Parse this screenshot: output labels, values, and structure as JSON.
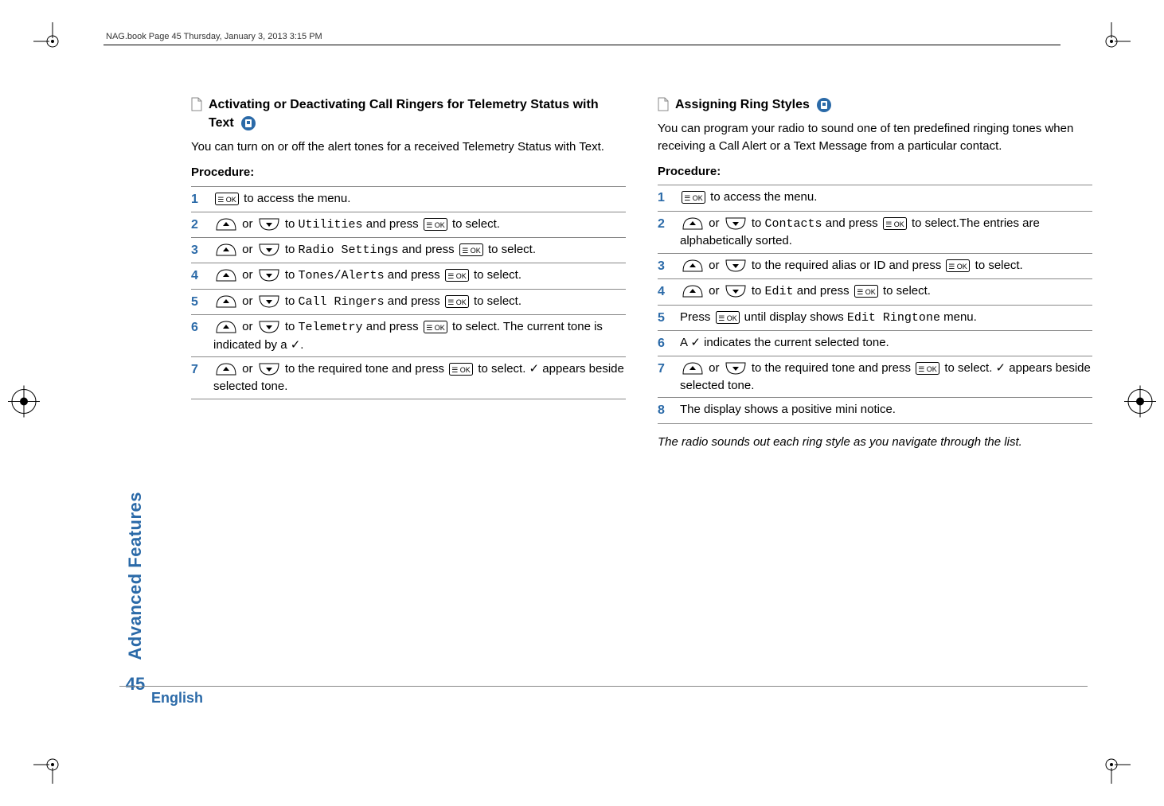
{
  "header": {
    "running_text": "NAG.book  Page 45  Thursday, January 3, 2013  3:15 PM"
  },
  "sidebar": {
    "label": "Advanced Features",
    "page_number": "45"
  },
  "footer": {
    "language": "English"
  },
  "left": {
    "title": "Activating or Deactivating Call Ringers for Telemetry Status with Text",
    "intro": "You can turn on or off the alert tones for a received Telemetry Status with Text.",
    "procedure_label": "Procedure:",
    "steps": {
      "s1a": " to access the menu.",
      "s2a": " or ",
      "s2b": " to ",
      "s2c": "Utilities",
      "s2d": " and press ",
      "s2e": " to select.",
      "s3a": " or ",
      "s3b": " to ",
      "s3c": "Radio Settings",
      "s3d": " and press ",
      "s3e": " to select.",
      "s4a": " or ",
      "s4b": " to ",
      "s4c": "Tones/Alerts",
      "s4d": " and press ",
      "s4e": " to select.",
      "s5a": " or ",
      "s5b": " to ",
      "s5c": "Call Ringers",
      "s5d": " and press ",
      "s5e": " to select.",
      "s6a": " or ",
      "s6b": " to ",
      "s6c": "Telemetry",
      "s6d": " and press ",
      "s6e": " to select. The current tone is indicated by a ✓.",
      "s7a": " or ",
      "s7b": " to the required tone and press ",
      "s7c": " to select. ✓ appears beside selected tone."
    }
  },
  "right": {
    "title": "Assigning Ring Styles",
    "intro": "You can program your radio to sound one of ten predefined ringing tones when receiving a Call Alert or a Text Message from a particular contact.",
    "procedure_label": "Procedure:",
    "steps": {
      "s1a": " to access the menu.",
      "s2a": " or ",
      "s2b": " to ",
      "s2c": "Contacts",
      "s2d": " and press ",
      "s2e": " to select.The entries are alphabetically sorted.",
      "s3a": " or ",
      "s3b": " to the required alias or ID and press ",
      "s3c": " to select.",
      "s4a": " or ",
      "s4b": " to ",
      "s4c": "Edit",
      "s4d": " and press ",
      "s4e": " to select.",
      "s5a": "Press ",
      "s5b": " until display shows ",
      "s5c": "Edit Ringtone",
      "s5d": " menu.",
      "s6a": "A ✓ indicates the current selected tone.",
      "s7a": " or ",
      "s7b": " to the required tone and press ",
      "s7c": " to select. ✓ appears beside selected tone.",
      "s8a": "The display shows a positive mini notice."
    },
    "note": "The radio sounds out each ring style as you navigate through the list."
  },
  "nums": {
    "n1": "1",
    "n2": "2",
    "n3": "3",
    "n4": "4",
    "n5": "5",
    "n6": "6",
    "n7": "7",
    "n8": "8"
  }
}
